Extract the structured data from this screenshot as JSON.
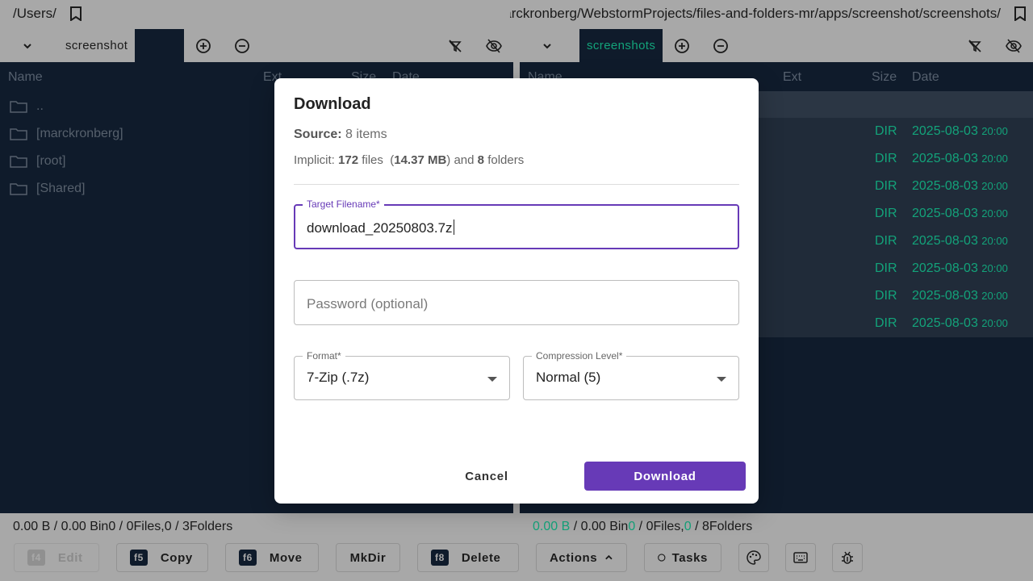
{
  "left": {
    "path": "/Users/",
    "tabs": [
      {
        "label": "screenshot"
      },
      {
        "label": ""
      }
    ],
    "columns": {
      "name": "Name",
      "ext": "Ext",
      "size": "Size",
      "date": "Date"
    },
    "rows": [
      {
        "name": ".."
      },
      {
        "name": "[marckronberg]"
      },
      {
        "name": "[root]"
      },
      {
        "name": "[Shared]"
      }
    ],
    "status": {
      "size_sel": "0.00 B",
      "size_total": "0.00 B",
      "in": "in",
      "files_sel": "0",
      "files_total": "0",
      "files_label": "Files,",
      "folders_sel": "0",
      "folders_total": "3",
      "folders_label": "Folders"
    }
  },
  "right": {
    "path": "arckronberg/WebstormProjects/files-and-folders-mr/apps/screenshot/screenshots/",
    "tabs": [
      {
        "label": "screenshots"
      }
    ],
    "columns": {
      "name": "Name",
      "ext": "Ext",
      "size": "Size",
      "date": "Date"
    },
    "rows": [
      {
        "size": "DIR",
        "date": "2025-08-03",
        "time": "20:00"
      },
      {
        "size": "DIR",
        "date": "2025-08-03",
        "time": "20:00"
      },
      {
        "size": "DIR",
        "date": "2025-08-03",
        "time": "20:00"
      },
      {
        "size": "DIR",
        "date": "2025-08-03",
        "time": "20:00"
      },
      {
        "size": "DIR",
        "date": "2025-08-03",
        "time": "20:00"
      },
      {
        "size": "DIR",
        "date": "2025-08-03",
        "time": "20:00"
      },
      {
        "size": "DIR",
        "date": "2025-08-03",
        "time": "20:00"
      },
      {
        "size": "DIR",
        "date": "2025-08-03",
        "time": "20:00"
      }
    ],
    "status": {
      "size_sel": "0.00 B",
      "size_total": "0.00 B",
      "in": "in",
      "files_sel": "0",
      "files_total": "0",
      "files_label": "Files,",
      "folders_sel": "0",
      "folders_total": "8",
      "folders_label": "Folders"
    }
  },
  "toolbar": {
    "edit": {
      "key": "f4",
      "label": "Edit"
    },
    "copy": {
      "key": "f5",
      "label": "Copy"
    },
    "move": {
      "key": "f6",
      "label": "Move"
    },
    "mkdir": {
      "label": "MkDir"
    },
    "delete": {
      "key": "f8",
      "label": "Delete"
    },
    "actions": {
      "label": "Actions"
    },
    "tasks": {
      "label": "Tasks"
    }
  },
  "dialog": {
    "title": "Download",
    "source_label": "Source:",
    "source_value": "8 items",
    "implicit_label": "Implicit:",
    "files_count": "172",
    "files_word": "files",
    "size": "14.37 MB",
    "and_word": "and",
    "folders_count": "8",
    "folders_word": "folders",
    "filename_label": "Target Filename*",
    "filename_value": "download_20250803.7z",
    "password_placeholder": "Password (optional)",
    "format_label": "Format*",
    "format_value": "7-Zip (.7z)",
    "compression_label": "Compression Level*",
    "compression_value": "Normal (5)",
    "cancel_label": "Cancel",
    "download_label": "Download"
  },
  "colors": {
    "accent": "#673ab7",
    "panel_bg": "#0f1b2b",
    "dir_green": "#13a37a",
    "overlay": "#a8a8a8"
  },
  "icons": [
    "bookmark-icon",
    "chevron-down-icon",
    "add-circle-icon",
    "remove-circle-icon",
    "filter-off-icon",
    "visibility-off-icon",
    "folder-icon",
    "chevron-up-icon",
    "circle-icon",
    "palette-icon",
    "keyboard-icon",
    "bug-icon"
  ]
}
